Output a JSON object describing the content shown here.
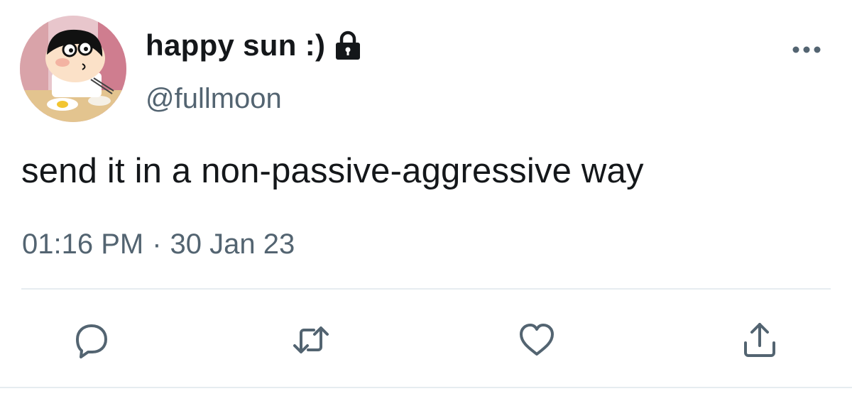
{
  "user": {
    "display_name": "happy sun :)",
    "handle": "@fullmoon",
    "avatar_icon": "cartoon-avatar",
    "protected_icon": "lock-icon"
  },
  "tweet": {
    "text": "send it in a non-passive-aggressive way",
    "time": "01:16 PM",
    "separator": "·",
    "date": "30 Jan 23"
  },
  "actions": {
    "reply_icon": "reply-icon",
    "retweet_icon": "retweet-icon",
    "like_icon": "heart-icon",
    "share_icon": "share-icon",
    "more_icon": "more-dots-icon"
  },
  "colors": {
    "text": "#14171a",
    "secondary": "#536471",
    "divider": "#e6ecf0"
  }
}
